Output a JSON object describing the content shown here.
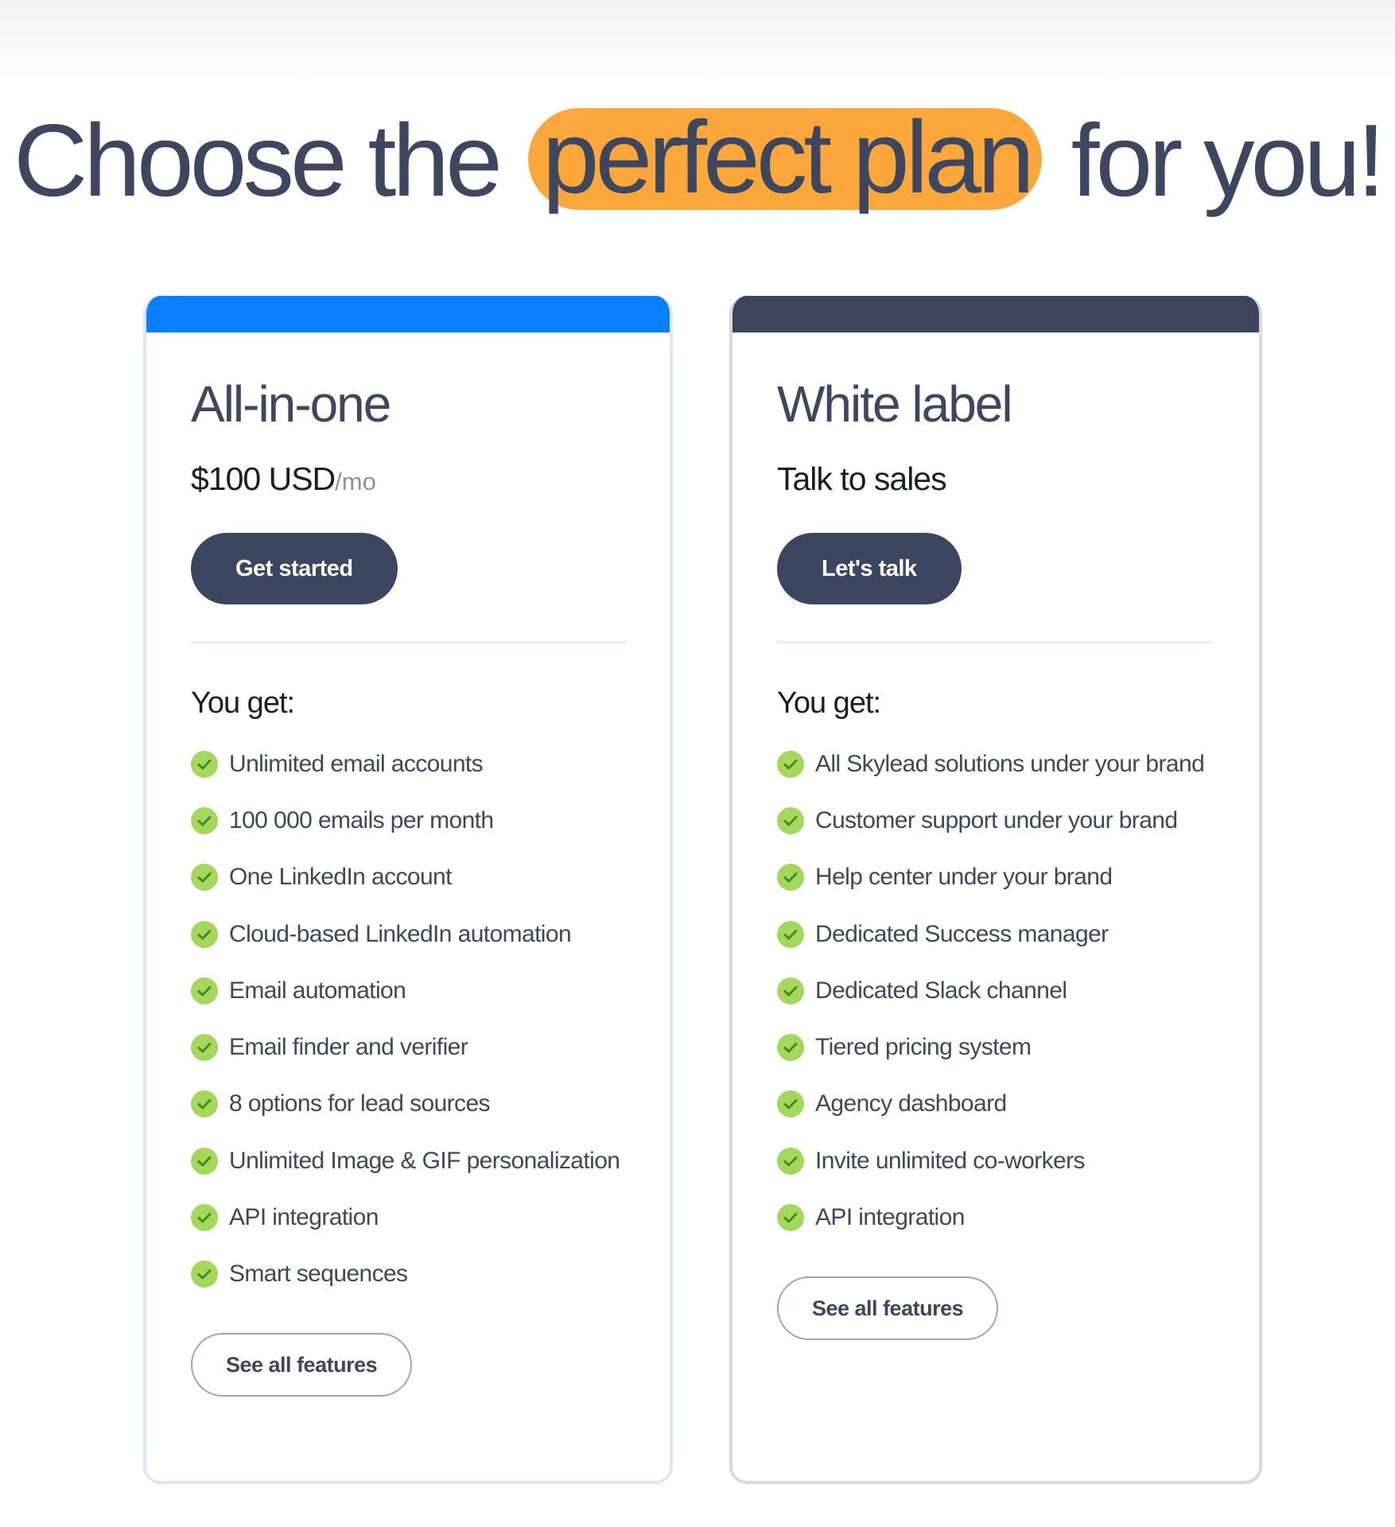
{
  "headline": {
    "before": "Choose the",
    "highlight": "perfect plan",
    "after": "for you!"
  },
  "colors": {
    "highlight": "#fba73b",
    "card_a_accent": "#0a7fff",
    "card_b_accent": "#3c455b",
    "check": "#a3d85c",
    "button": "#3c4660",
    "text": "#3d4760"
  },
  "plans": [
    {
      "title": "All-in-one",
      "price": "$100 USD",
      "period": "/mo",
      "cta_label": "Get started",
      "features_heading": "You get:",
      "feature_icon": "check-circle-icon",
      "features": [
        "Unlimited email accounts",
        "100 000 emails per month",
        "One LinkedIn account",
        "Cloud-based LinkedIn automation",
        "Email automation",
        "Email finder and verifier",
        "8 options for lead sources",
        "Unlimited Image & GIF personalization",
        "API integration",
        "Smart sequences"
      ],
      "see_all_label": "See all features"
    },
    {
      "title": "White label",
      "price": "Talk to sales",
      "cta_label": "Let's talk",
      "features_heading": "You get:",
      "feature_icon": "check-circle-icon",
      "features": [
        "All Skylead solutions under your brand",
        "Customer support under your brand",
        "Help center under your brand",
        "Dedicated Success manager",
        "Dedicated Slack channel",
        "Tiered pricing system",
        "Agency dashboard",
        "Invite unlimited co-workers",
        "API integration"
      ],
      "see_all_label": "See all features"
    }
  ]
}
